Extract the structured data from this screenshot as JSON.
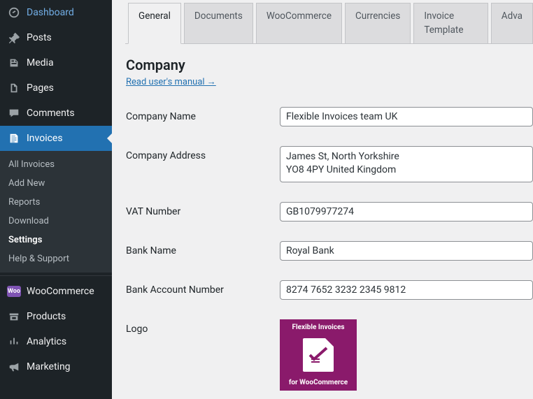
{
  "sidebar": {
    "top": [
      {
        "label": "Dashboard"
      },
      {
        "label": "Posts"
      },
      {
        "label": "Media"
      },
      {
        "label": "Pages"
      },
      {
        "label": "Comments"
      },
      {
        "label": "Invoices"
      }
    ],
    "submenu": [
      {
        "label": "All Invoices"
      },
      {
        "label": "Add New"
      },
      {
        "label": "Reports"
      },
      {
        "label": "Download"
      },
      {
        "label": "Settings"
      },
      {
        "label": "Help & Support"
      }
    ],
    "bottom": [
      {
        "label": "WooCommerce"
      },
      {
        "label": "Products"
      },
      {
        "label": "Analytics"
      },
      {
        "label": "Marketing"
      }
    ]
  },
  "tabs": [
    "General",
    "Documents",
    "WooCommerce",
    "Currencies",
    "Invoice Template",
    "Adva"
  ],
  "section": {
    "title": "Company",
    "manual_link": "Read user's manual →"
  },
  "fields": {
    "company_name": {
      "label": "Company Name",
      "value": "Flexible Invoices team UK"
    },
    "company_address": {
      "label": "Company Address",
      "value": "James St, North Yorkshire\nYO8 4PY United Kingdom"
    },
    "vat_number": {
      "label": "VAT Number",
      "value": "GB1079977274"
    },
    "bank_name": {
      "label": "Bank Name",
      "value": "Royal Bank"
    },
    "bank_account": {
      "label": "Bank Account Number",
      "value": "8274 7652 3232 2345 9812"
    },
    "logo": {
      "label": "Logo",
      "line1": "Flexible Invoices",
      "line2": "for WooCommerce"
    }
  }
}
